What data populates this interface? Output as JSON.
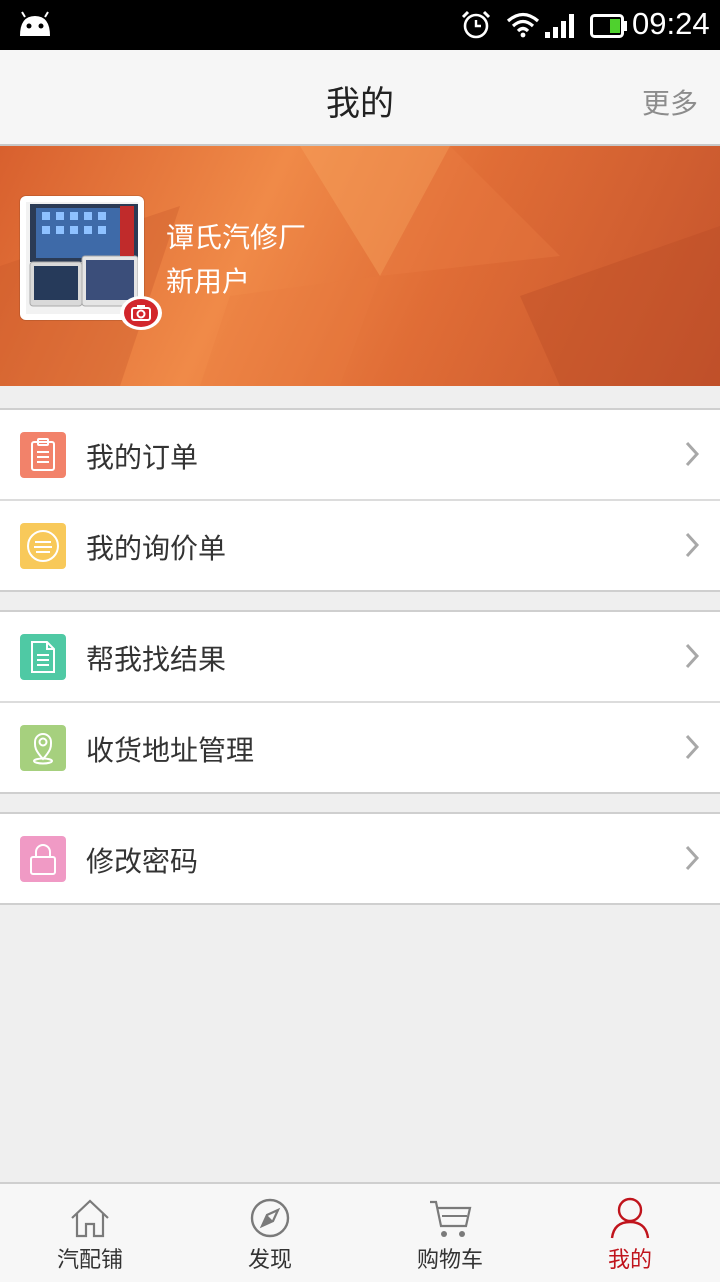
{
  "status_bar": {
    "time": "09:24",
    "icons": [
      "android-icon",
      "alarm-icon",
      "wifi-icon",
      "signal-icon",
      "battery-icon"
    ]
  },
  "header": {
    "title": "我的",
    "more_label": "更多"
  },
  "profile": {
    "name": "谭氏汽修厂",
    "user_type": "新用户",
    "accent_color": "#e06d36"
  },
  "menu_groups": [
    {
      "items": [
        {
          "label": "我的订单",
          "icon": "clipboard-icon",
          "color": "#f2826a"
        },
        {
          "label": "我的询价单",
          "icon": "list-circle-icon",
          "color": "#f8c95a"
        }
      ]
    },
    {
      "items": [
        {
          "label": "帮我找结果",
          "icon": "document-icon",
          "color": "#4fc9a4"
        },
        {
          "label": "收货地址管理",
          "icon": "location-pin-icon",
          "color": "#a6d07e"
        }
      ]
    },
    {
      "items": [
        {
          "label": "修改密码",
          "icon": "lock-icon",
          "color": "#f09ac5"
        }
      ]
    }
  ],
  "tab_bar": {
    "active_color": "#c0141c",
    "tabs": [
      {
        "label": "汽配铺",
        "icon": "home-icon",
        "active": false
      },
      {
        "label": "发现",
        "icon": "compass-icon",
        "active": false
      },
      {
        "label": "购物车",
        "icon": "cart-icon",
        "active": false
      },
      {
        "label": "我的",
        "icon": "user-icon",
        "active": true
      }
    ]
  }
}
